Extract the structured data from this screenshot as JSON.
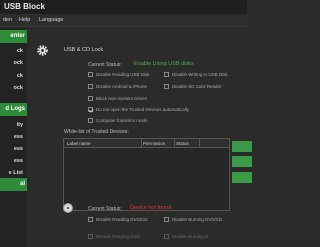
{
  "app": {
    "title": "USB Block"
  },
  "menu": [
    "den",
    "Help",
    "Language"
  ],
  "sidebar": {
    "section1": "enter",
    "items1": [
      "ck",
      "ock",
      "ck",
      "ock"
    ],
    "section2": "d Logs",
    "items2": [
      "ity",
      "ess",
      "ess",
      "ess",
      "e List"
    ],
    "section3": "al"
  },
  "usb_section": {
    "title": "USB & CD Lock",
    "status_label": "Current Status:",
    "status_value": "Enable Using USB disks",
    "status_color": "#4caf50",
    "options": [
      {
        "label": "Disable Reading USB Disk",
        "checked": false
      },
      {
        "label": "Disable Writing to USB Disk",
        "checked": false
      },
      {
        "label": "Disable Android & iPhone",
        "checked": false
      },
      {
        "label": "Disable SD Card Reader",
        "checked": false
      },
      {
        "label": "Block Non-System Drives",
        "checked": false
      },
      {
        "label": "Do not open the Trusted Devices automatically",
        "checked": true
      },
      {
        "label": "Computer forensics mode",
        "checked": false
      }
    ],
    "whitelist_label": "White-list of Trusted Devices:",
    "columns": [
      "Label name",
      "Permission",
      "Status"
    ]
  },
  "cd_section": {
    "status_label": "Current Status:",
    "status_value": "Device not found",
    "status_color": "#e53935",
    "options": [
      {
        "label": "Disable Reading DVD/CD",
        "checked": false
      },
      {
        "label": "Disable Burning DVD/CD",
        "checked": false
      },
      {
        "label": "Disable Reading DVD",
        "checked": false,
        "dim": true
      },
      {
        "label": "Disable Burning D",
        "checked": false,
        "dim": true
      }
    ]
  },
  "colors": {
    "accent": "#2e8b3a",
    "button": "#3a9a45"
  }
}
